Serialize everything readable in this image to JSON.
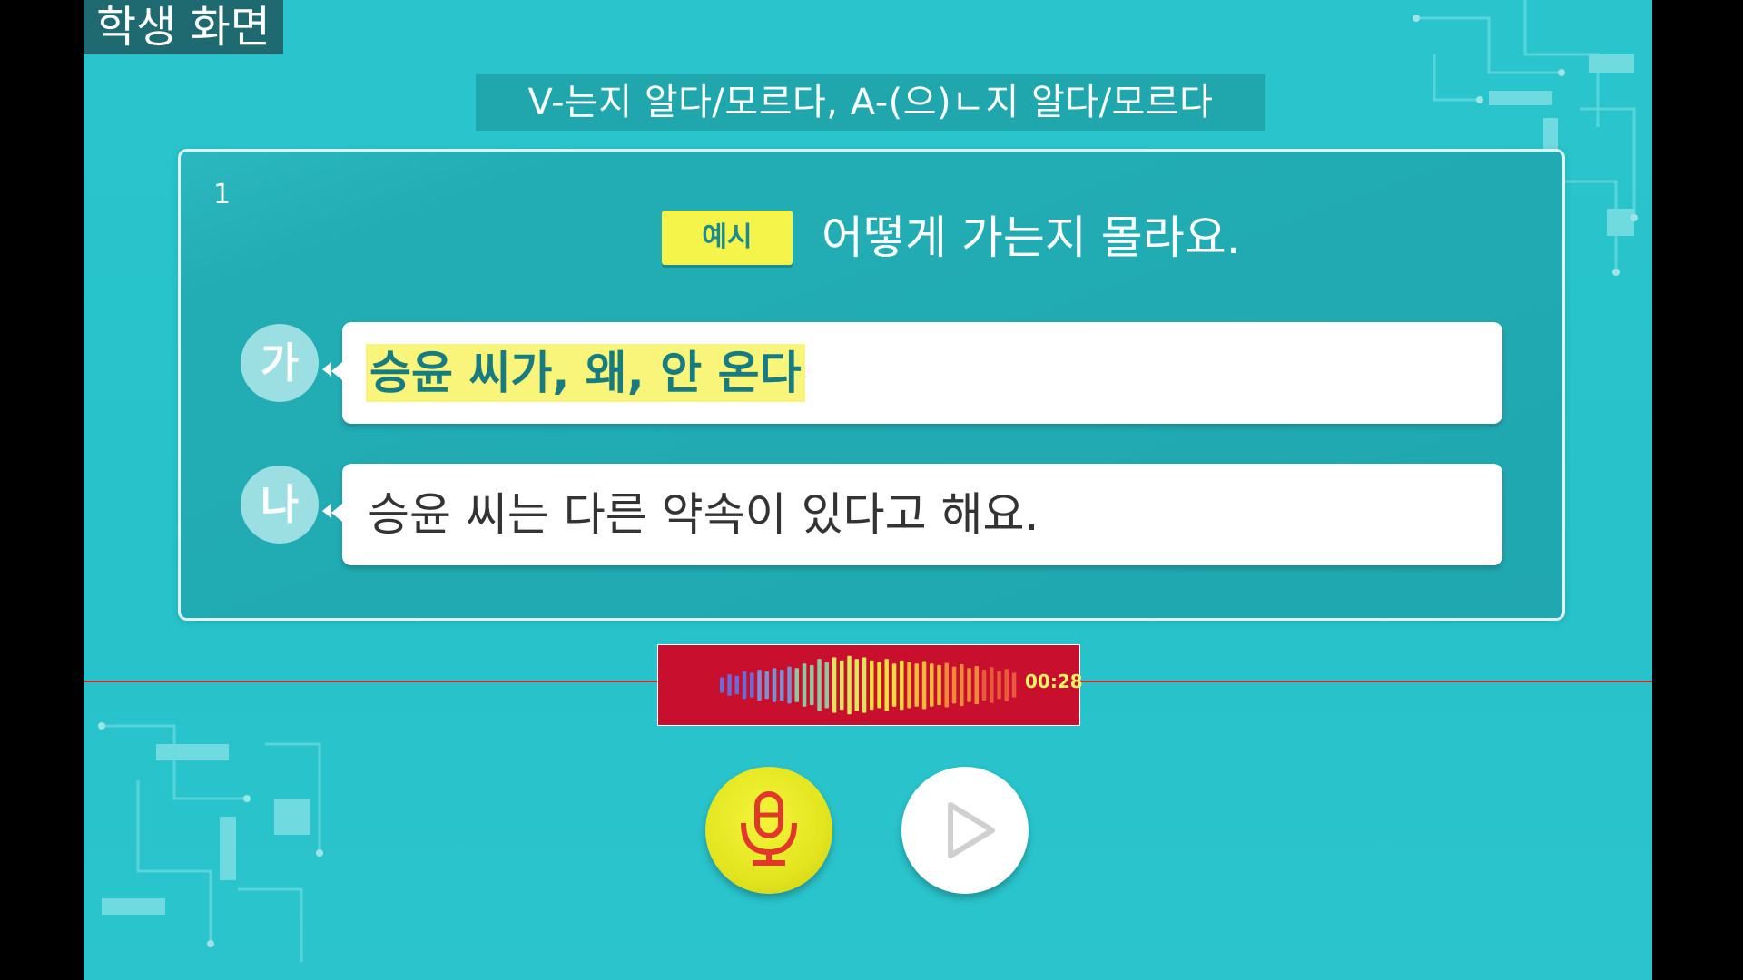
{
  "screen_label": "학생 화면",
  "grammar_title": "V-는지 알다/모르다, A-(으)ㄴ지 알다/모르다",
  "question": {
    "number": "1",
    "example_badge": "예시",
    "example_sentence": "어떻게 가는지 몰라요."
  },
  "dialogue": {
    "a": {
      "speaker": "가",
      "text": "승윤 씨가, 왜, 안 온다"
    },
    "b": {
      "speaker": "나",
      "text": "승윤 씨는 다른 약속이 있다고 해요."
    }
  },
  "recorder": {
    "time": "00:28",
    "waveform_levels": [
      0.25,
      0.35,
      0.3,
      0.45,
      0.4,
      0.5,
      0.45,
      0.55,
      0.5,
      0.6,
      0.55,
      0.7,
      0.65,
      0.85,
      0.75,
      0.9,
      0.8,
      0.95,
      0.85,
      0.9,
      0.8,
      0.75,
      0.85,
      0.7,
      0.8,
      0.75,
      0.7,
      0.78,
      0.7,
      0.65,
      0.72,
      0.6,
      0.68,
      0.55,
      0.62,
      0.5,
      0.58,
      0.45,
      0.52,
      0.4
    ]
  },
  "controls": {
    "mic_icon": "microphone-icon",
    "play_icon": "play-icon"
  },
  "colors": {
    "background": "#2ac5cc",
    "highlight": "#f8f57a",
    "recorder_bg": "#c8102e",
    "mic_button": "#e3e51f"
  }
}
